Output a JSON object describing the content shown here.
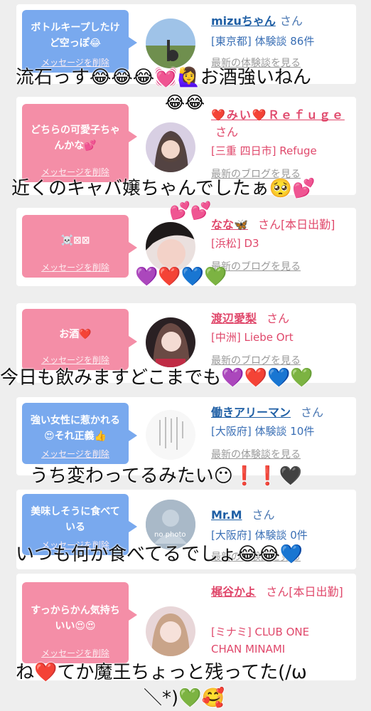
{
  "cards": [
    {
      "message": "ボトルキープしたけど空っぽ😂",
      "delete_label": "メッセージを削除",
      "name": "mizuちゃん",
      "honorific": "さん",
      "meta1": "[東京都] 体験談 86件",
      "link": "最新の体験談を見る"
    },
    {
      "message": "どちらの可愛子ちゃんかな💕",
      "delete_label": "メッセージを削除",
      "name": "❤️みい❤️Ｒｅｆｕｇｅ",
      "honorific": "さん",
      "meta1": "[三重 四日市] Refuge",
      "link": "最新のブログを見る"
    },
    {
      "message": "☠️⊠⊠",
      "delete_label": "メッセージを削除",
      "name": "なな🦋",
      "honorific": "さん[本日出勤]",
      "meta1": "[浜松] D3",
      "link": "最新のブログを見る"
    },
    {
      "message": "お酒❤️",
      "delete_label": "メッセージを削除",
      "name": "渡辺愛梨",
      "honorific": "さん",
      "meta1": "[中洲] Liebe Ort",
      "link": "最新のブログを見る"
    },
    {
      "message": "強い女性に惹かれる😍それ正義👍",
      "delete_label": "メッセージを削除",
      "name": "働きアリーマン",
      "honorific": "さん",
      "meta1": "[大阪府] 体験談 10件",
      "link": "最新の体験談を見る"
    },
    {
      "message": "美味しそうに食べている",
      "delete_label": "メッセージを削除",
      "name": "Mr.M",
      "honorific": "さん",
      "meta1": "[大阪府] 体験談 0件",
      "link": "最新の体験談を見る",
      "avatar_text": "no photo"
    },
    {
      "message": "すっからかん気持ちいい😍😍",
      "delete_label": "メッセージを削除",
      "name": "梶谷かよ",
      "honorific": "さん[本日出勤]",
      "meta1": "[ミナミ] CLUB ONE CHAN MINAMI",
      "link": ""
    }
  ],
  "captions": {
    "c1": "流石っす😂😂😂💓🙋‍♀️お酒強いねん",
    "c1b": "😂😂",
    "c2": "近くのキャバ嬢ちゃんでしたぁ🥺💕",
    "c2b": "💕💕",
    "c3": "💜❤️💙💚",
    "c4": "今日も飲みますどこまでも💜❤️💙💚",
    "c5": "うち変わってるみたい😶❗️❗️🖤",
    "c6": "いつも何か食べてるでしょ😂😂💙",
    "c7a": "ね❤️てか魔王ちょっと残ってた(/ω",
    "c7b": "＼*)💚🥰"
  },
  "colors": {
    "bubble_blue": "#79a9ee",
    "bubble_pink": "#f48ea7",
    "name_blue": "#1f5fa5",
    "name_pink": "#e0486b"
  }
}
